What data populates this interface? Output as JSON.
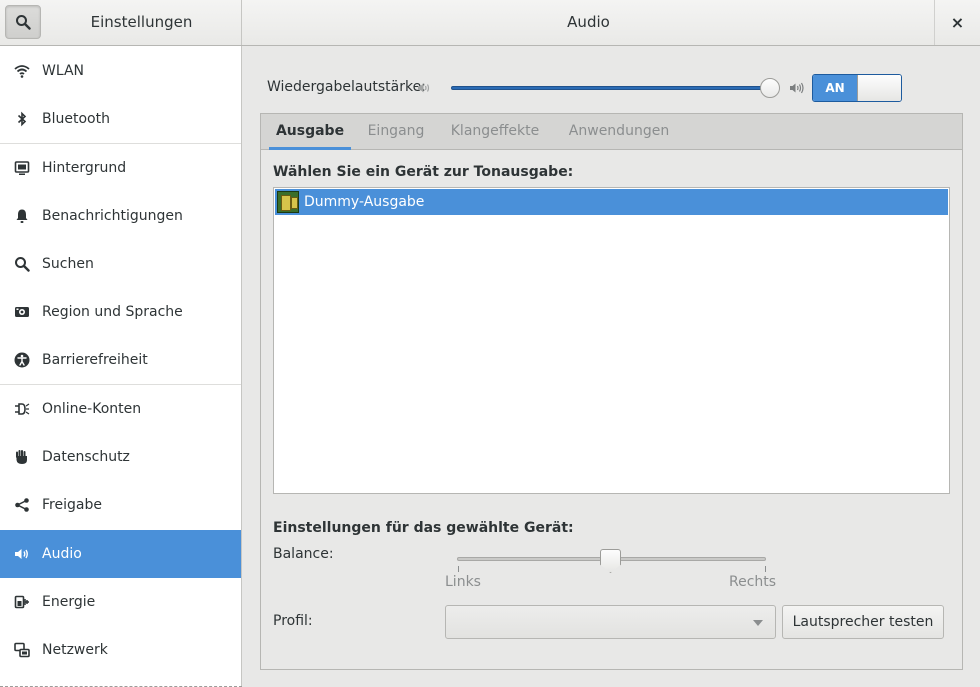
{
  "header": {
    "left_title": "Einstellungen",
    "title": "Audio",
    "close_glyph": "×",
    "search_icon": "search-icon"
  },
  "sidebar": {
    "items": [
      {
        "label": "WLAN",
        "icon": "wifi-icon"
      },
      {
        "label": "Bluetooth",
        "icon": "bluetooth-icon"
      },
      {
        "label": "Hintergrund",
        "icon": "background-icon"
      },
      {
        "label": "Benachrichtigungen",
        "icon": "bell-icon"
      },
      {
        "label": "Suchen",
        "icon": "search-icon"
      },
      {
        "label": "Region und Sprache",
        "icon": "region-icon"
      },
      {
        "label": "Barrierefreiheit",
        "icon": "accessibility-icon"
      },
      {
        "label": "Online-Konten",
        "icon": "online-accounts-icon"
      },
      {
        "label": "Datenschutz",
        "icon": "privacy-hand-icon"
      },
      {
        "label": "Freigabe",
        "icon": "share-icon"
      },
      {
        "label": "Audio",
        "icon": "speaker-icon",
        "active": true
      },
      {
        "label": "Energie",
        "icon": "power-icon"
      },
      {
        "label": "Netzwerk",
        "icon": "network-icon"
      }
    ]
  },
  "volume": {
    "label": "Wiedergabelautstärke:",
    "level": 1.0,
    "switch_label": "AN"
  },
  "tabs": [
    {
      "label": "Ausgabe",
      "active": true
    },
    {
      "label": "Eingang"
    },
    {
      "label": "Klangeffekte"
    },
    {
      "label": "Anwendungen"
    }
  ],
  "output": {
    "choose_label": "Wählen Sie ein Gerät zur Tonausgabe:",
    "devices": [
      "Dummy-Ausgabe"
    ],
    "settings_label": "Einstellungen für das gewählte Gerät:",
    "balance_label": "Balance:",
    "balance_left": "Links",
    "balance_right": "Rechts",
    "balance_value": 0.5,
    "profile_label": "Profil:",
    "profile_value": "",
    "test_button": "Lautsprecher testen"
  },
  "colors": {
    "accent": "#4a90d9"
  }
}
